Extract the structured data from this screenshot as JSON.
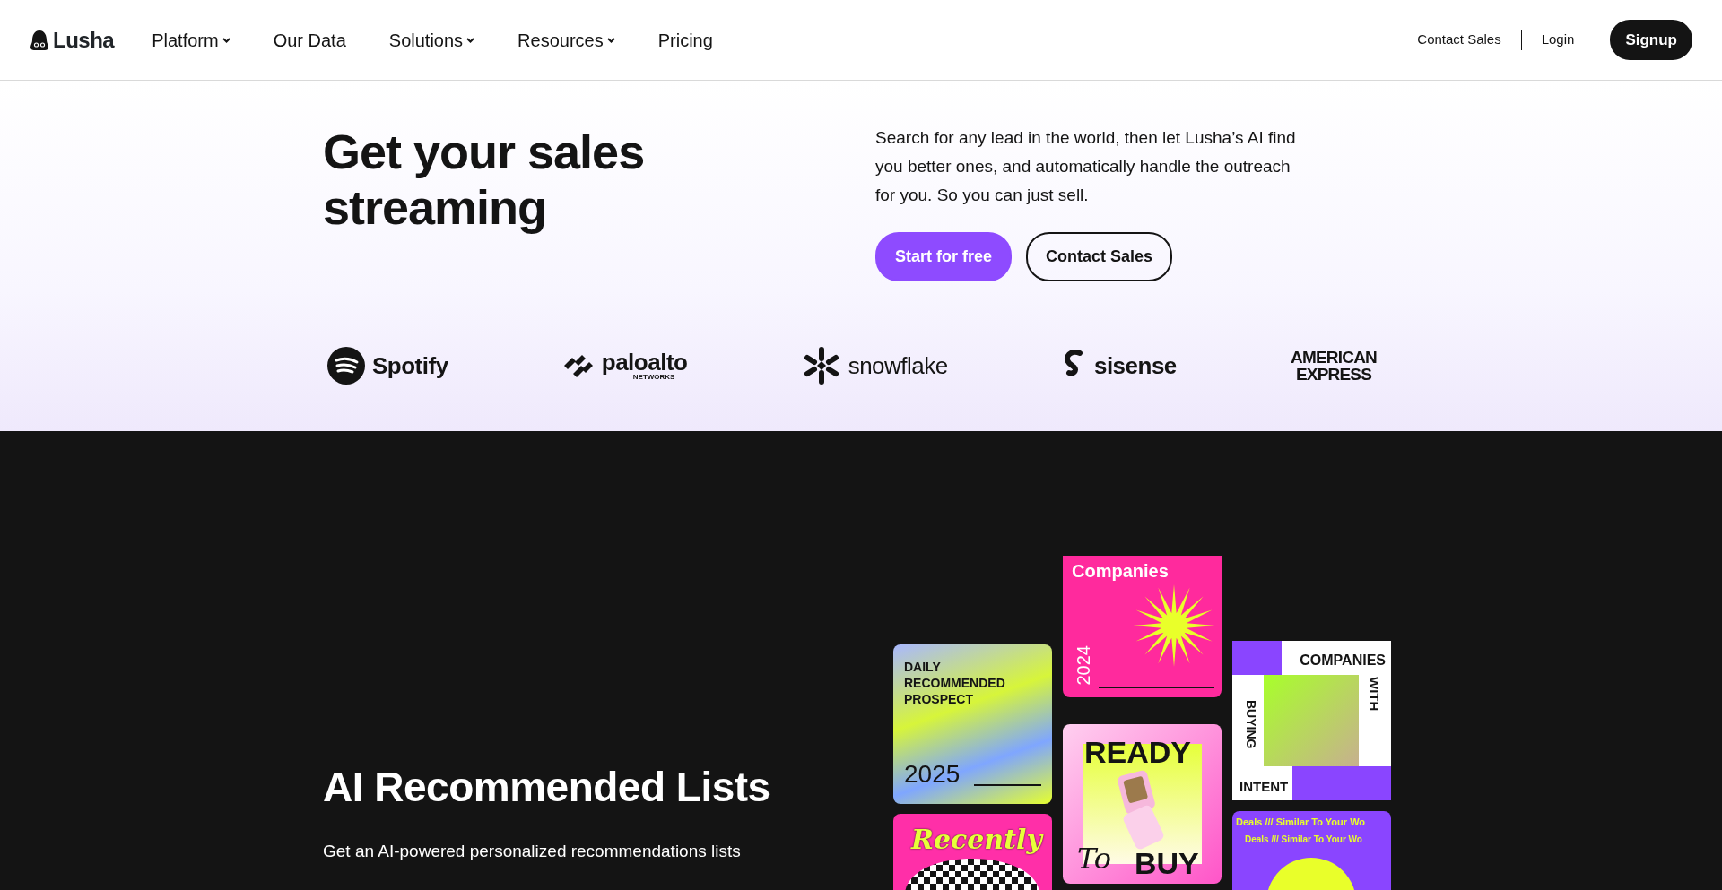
{
  "nav": {
    "logo": "Lusha",
    "links": [
      {
        "label": "Platform",
        "dropdown": true
      },
      {
        "label": "Our Data",
        "dropdown": false
      },
      {
        "label": "Solutions",
        "dropdown": true
      },
      {
        "label": "Resources",
        "dropdown": true
      },
      {
        "label": "Pricing",
        "dropdown": false
      }
    ],
    "right_links": [
      "Contact Sales",
      "Login"
    ],
    "signup": "Signup"
  },
  "hero": {
    "title": "Get your sales streaming",
    "text": "Search for any lead in the world, then let Lusha’s AI find you better ones, and automatically handle the outreach for you. So you can just sell.",
    "buttons": [
      {
        "label": "Start for free",
        "kind": "primary"
      },
      {
        "label": "Contact Sales",
        "kind": "outline"
      }
    ]
  },
  "logos": [
    {
      "kind": "waves",
      "lines": [
        "Spotify"
      ]
    },
    {
      "kind": "stripes",
      "lines": [
        "paloalto",
        "NETWORKS"
      ]
    },
    {
      "kind": "snowflake",
      "lines": [
        "snowflake"
      ]
    },
    {
      "kind": "s-mark",
      "lines": [
        "sisense"
      ]
    },
    {
      "kind": "wordmark",
      "lines": [
        "AMERICAN",
        "EXPRESS"
      ]
    }
  ],
  "feature": {
    "title": "AI Recommended Lists",
    "text": "Get an AI-powered personalized recommendations lists",
    "columns": [
      [
        {
          "kind": "prospect",
          "texts": [
            "DAILY RECOMMENDED PROSPECT",
            "2025"
          ]
        },
        {
          "kind": "recently",
          "texts": [
            "Recently"
          ]
        }
      ],
      [
        {
          "kind": "sunburst",
          "texts": [
            "Companies",
            "2024"
          ]
        },
        {
          "kind": "phone",
          "texts": [
            "READY",
            "To",
            "BUY"
          ]
        }
      ],
      [
        {
          "kind": "intent",
          "texts": [
            "COMPANIES",
            "WITH",
            "BUYING",
            "INTENT"
          ]
        },
        {
          "kind": "deals",
          "texts": [
            "Deals /// Similar To Your Wo",
            "Deals /// Similar To Your Wo"
          ]
        }
      ]
    ]
  }
}
